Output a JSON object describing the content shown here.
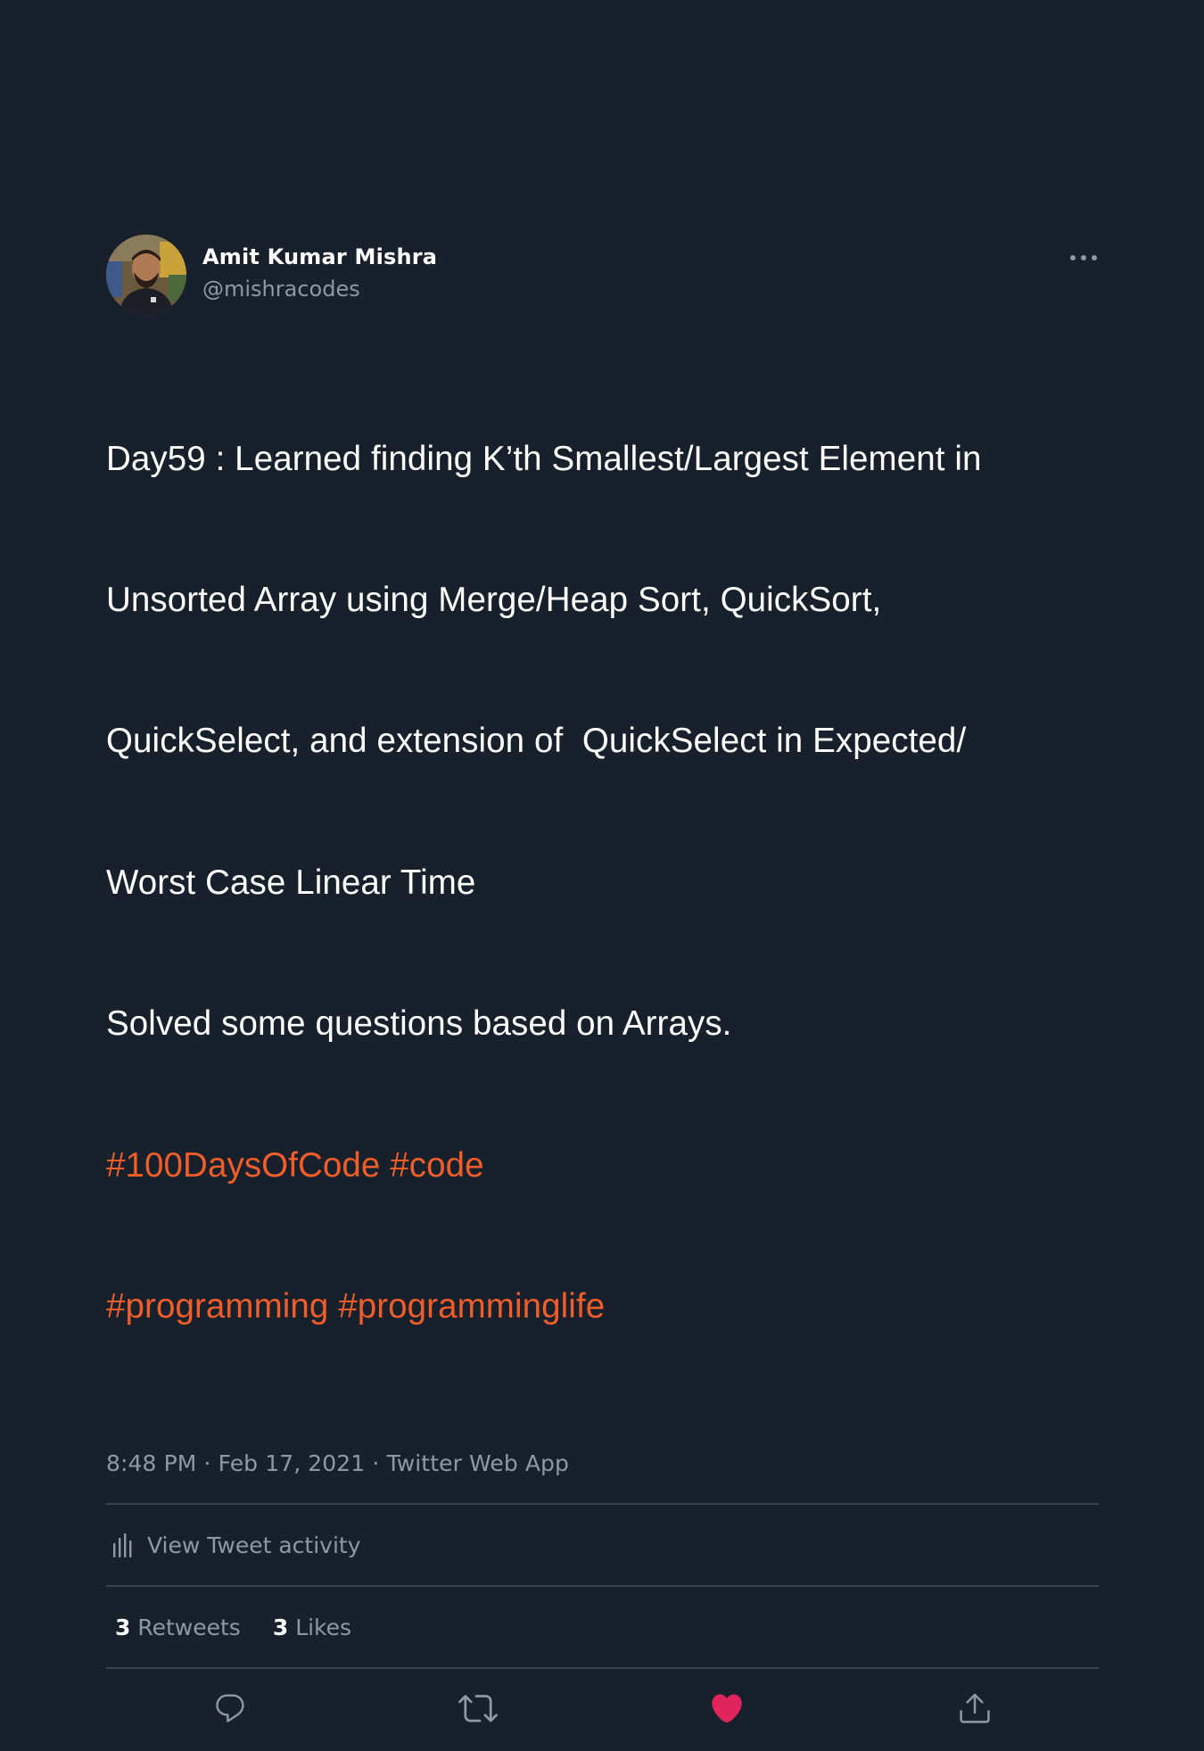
{
  "author": {
    "display_name": "Amit Kumar Mishra",
    "handle": "@mishracodes"
  },
  "tweet": {
    "lines": [
      "Day59 : Learned finding K’th Smallest/Largest Element in",
      "Unsorted Array using Merge/Heap Sort, QuickSort,",
      "QuickSelect, and extension of  QuickSelect in Expected/",
      "Worst Case Linear Time",
      "Solved some questions based on Arrays."
    ],
    "hashtag_lines": [
      [
        "#100DaysOfCode",
        "#code"
      ],
      [
        "#programming",
        "#programminglife"
      ]
    ]
  },
  "meta": {
    "time": "8:48 PM",
    "date": "Feb 17, 2021",
    "separator": "·",
    "source": "Twitter Web App"
  },
  "activity": {
    "label": "View Tweet activity"
  },
  "stats": {
    "retweets_count": "3",
    "retweets_label": "Retweets",
    "likes_count": "3",
    "likes_label": "Likes"
  },
  "colors": {
    "background": "#17202b",
    "hashtag": "#ef5d2a",
    "liked_heart": "#e0245e",
    "muted": "#8d99a5",
    "divider": "#38444d"
  },
  "icons": {
    "more": "more-horizontal-icon",
    "activity": "bar-chart-icon",
    "reply": "reply-bubble-icon",
    "retweet": "retweet-icon",
    "like": "heart-filled-icon",
    "share": "share-upload-icon"
  }
}
